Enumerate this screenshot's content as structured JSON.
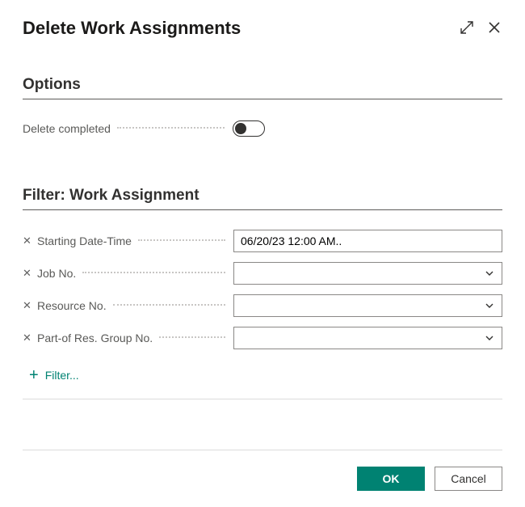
{
  "title": "Delete Work Assignments",
  "sections": {
    "options": {
      "heading": "Options",
      "deleteCompleted": {
        "label": "Delete completed",
        "value": false
      }
    },
    "filter": {
      "heading": "Filter: Work Assignment",
      "rows": [
        {
          "label": "Starting Date-Time",
          "value": "06/20/23 12:00 AM..",
          "kind": "text"
        },
        {
          "label": "Job No.",
          "value": "",
          "kind": "dropdown"
        },
        {
          "label": "Resource No.",
          "value": "",
          "kind": "dropdown"
        },
        {
          "label": "Part-of Res. Group No.",
          "value": "",
          "kind": "dropdown"
        }
      ],
      "addFilterLabel": "Filter..."
    }
  },
  "buttons": {
    "ok": "OK",
    "cancel": "Cancel"
  },
  "colors": {
    "accent": "#008272"
  }
}
